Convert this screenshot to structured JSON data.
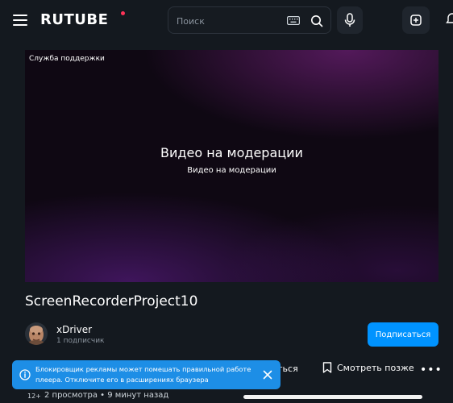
{
  "header": {
    "logo_text": "RUTUBE",
    "search_placeholder": "Поиск"
  },
  "player": {
    "support_link": "Служба поддержки",
    "status_title": "Видео на модерации",
    "status_subtitle": "Видео на модерации"
  },
  "video": {
    "title": "ScreenRecorderProject10",
    "channel_name": "xDriver",
    "subscribers": "1 подписчик",
    "subscribe_label": "Подписаться"
  },
  "actions": {
    "share_partial": "иться",
    "watch_later_label": "Смотреть позже",
    "more_label": "•••"
  },
  "meta": {
    "age_rating": "12+",
    "stats": "2 просмотра  •  9 минут назад"
  },
  "toast": {
    "message": "Блокировщик рекламы может помешать правильной работе плеера. Отключите его в расширениях браузера"
  },
  "colors": {
    "background": "#14191f",
    "accent": "#0093ff",
    "toast": "#1d8ee6",
    "logo_dot": "#ff3358"
  },
  "icons": [
    "menu-icon",
    "keyboard-icon",
    "search-icon",
    "microphone-icon",
    "upload-icon",
    "bookmark-icon",
    "info-icon",
    "close-icon"
  ]
}
